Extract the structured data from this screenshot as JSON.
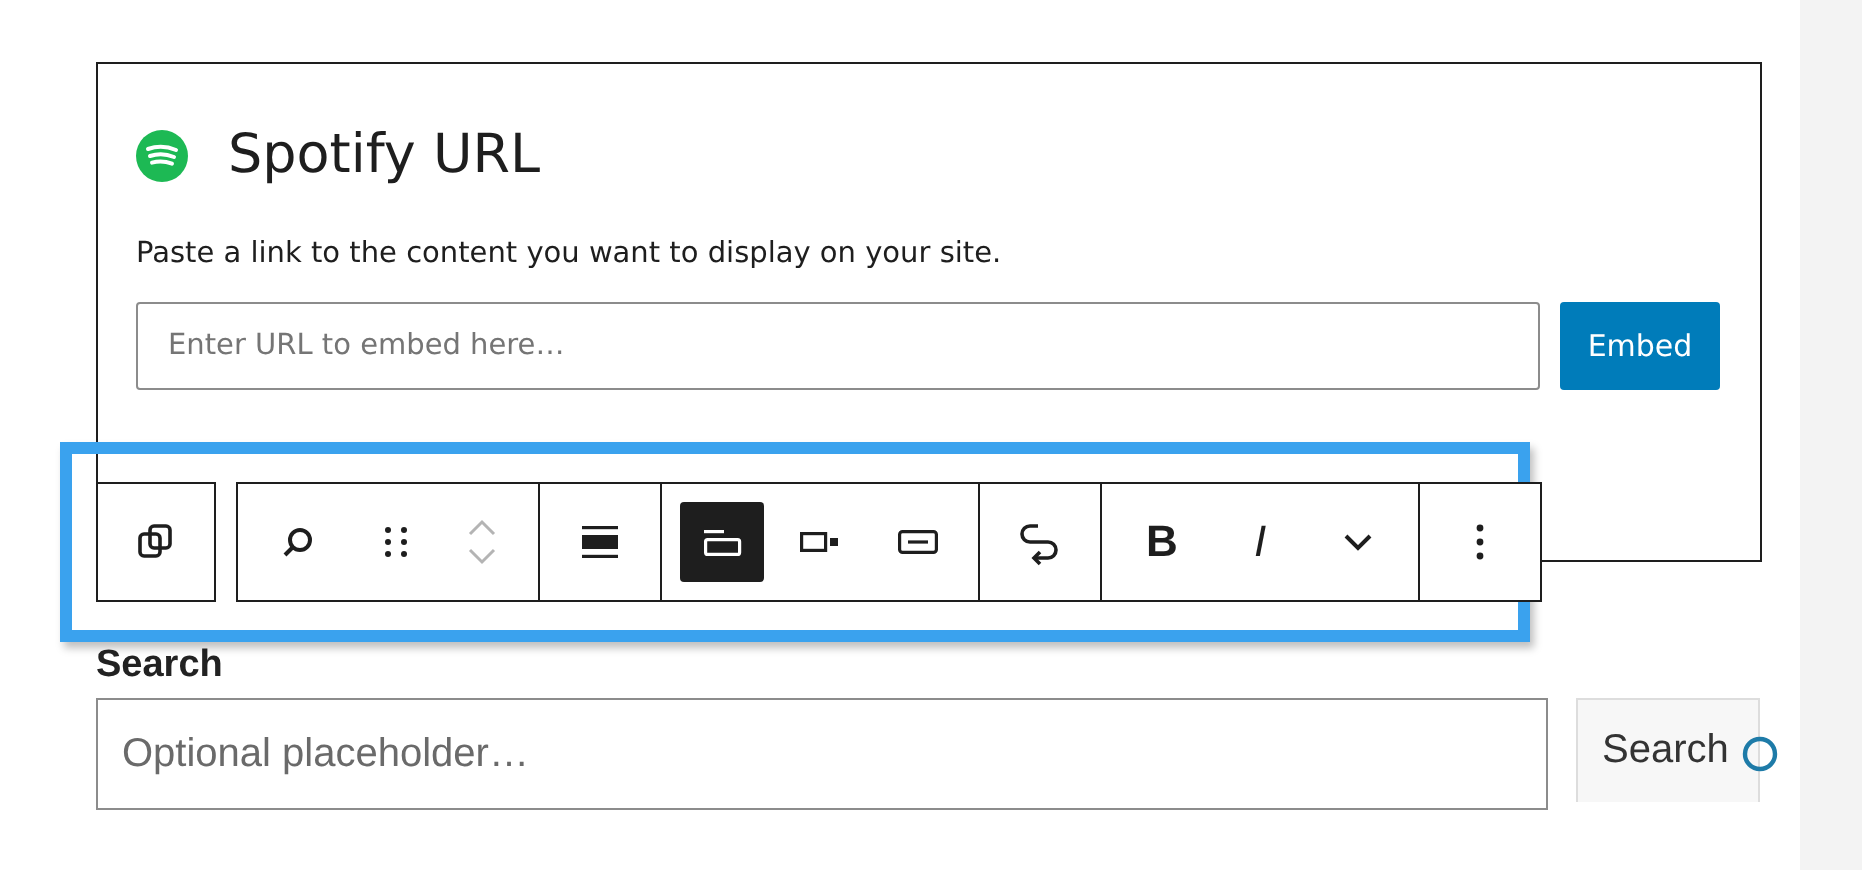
{
  "embed": {
    "title": "Spotify URL",
    "instructions": "Paste a link to the content you want to display on your site.",
    "placeholder": "Enter URL to embed here…",
    "button": "Embed"
  },
  "toolbar": {
    "groups": [
      {
        "tools": [
          {
            "kind": "duplicate"
          }
        ]
      },
      {
        "tools": [
          {
            "kind": "search"
          },
          {
            "kind": "drag"
          },
          {
            "kind": "mover",
            "disabled": true
          }
        ]
      },
      {
        "tools": [
          {
            "kind": "align-full"
          }
        ]
      },
      {
        "tools": [
          {
            "kind": "align-left",
            "selected": true
          },
          {
            "kind": "align-right",
            "selected": false
          },
          {
            "kind": "align-center",
            "selected": false
          }
        ]
      },
      {
        "tools": [
          {
            "kind": "loop"
          }
        ]
      },
      {
        "tools": [
          {
            "kind": "text",
            "label": "B",
            "bold": true
          },
          {
            "kind": "text",
            "label": "I",
            "bold": false
          },
          {
            "kind": "chevron"
          }
        ]
      },
      {
        "tools": [
          {
            "kind": "more"
          }
        ]
      }
    ]
  },
  "search": {
    "label": "Search",
    "placeholder": "Optional placeholder…",
    "button": "Search"
  }
}
